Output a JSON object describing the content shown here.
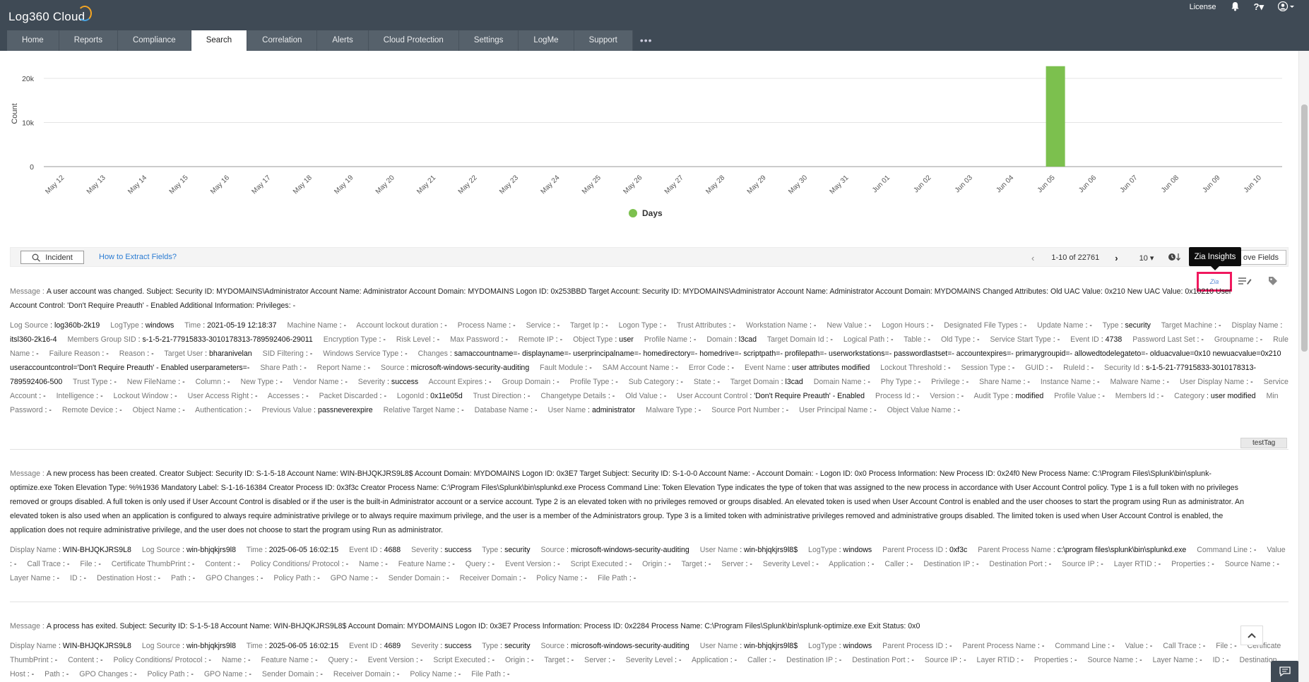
{
  "app": {
    "name": "Log360 Cloud"
  },
  "topright": {
    "license": "License",
    "help": "?"
  },
  "nav": {
    "tabs": [
      "Home",
      "Reports",
      "Compliance",
      "Search",
      "Correlation",
      "Alerts",
      "Cloud Protection",
      "Settings",
      "LogMe",
      "Support"
    ],
    "more": "•••",
    "active": "Search"
  },
  "chart_data": {
    "type": "bar",
    "categories": [
      "May 12",
      "May 13",
      "May 14",
      "May 15",
      "May 16",
      "May 17",
      "May 18",
      "May 19",
      "May 20",
      "May 21",
      "May 22",
      "May 23",
      "May 24",
      "May 25",
      "May 26",
      "May 27",
      "May 28",
      "May 29",
      "May 30",
      "May 31",
      "Jun 01",
      "Jun 02",
      "Jun 03",
      "Jun 04",
      "Jun 05",
      "Jun 06",
      "Jun 07",
      "Jun 08",
      "Jun 09",
      "Jun 10"
    ],
    "series": [
      {
        "name": "Days",
        "values": [
          0,
          0,
          0,
          0,
          0,
          0,
          0,
          0,
          0,
          0,
          0,
          0,
          0,
          0,
          0,
          0,
          0,
          0,
          0,
          0,
          0,
          0,
          0,
          0,
          22761,
          0,
          0,
          0,
          0,
          0
        ]
      }
    ],
    "ylabel": "Count",
    "yticks": [
      "0",
      "10k",
      "20k"
    ],
    "ylim": [
      0,
      24000
    ],
    "legend": "bottom-center",
    "color": "#7cc04e"
  },
  "toolbar": {
    "incident": "Incident",
    "extract_link": "How to Extract Fields?",
    "range": "1-10 of 22761",
    "page_size": "10",
    "fields_btn": "ove Fields",
    "tooltip": "Zia Insights",
    "zia": "Zia"
  },
  "logs": [
    {
      "message_key": "Message :",
      "message": "A user account was changed. Subject: Security ID: MYDOMAINS\\Administrator Account Name: Administrator Account Domain: MYDOMAINS Logon ID: 0x253BBD Target Account: Security ID: MYDOMAINS\\Administrator Account Name: Administrator Account Domain: MYDOMAINS Changed Attributes: Old UAC Value: 0x210 New UAC Value: 0x10210 User Account Control: 'Don't Require Preauth' - Enabled Additional Information: Privileges: -",
      "fields": [
        [
          "Log Source",
          "log360b-2k19"
        ],
        [
          "LogType",
          "windows"
        ],
        [
          "Time",
          "2021-05-19 12:18:37"
        ],
        [
          "Machine Name",
          "-"
        ],
        [
          "Account lockout duration",
          "-"
        ],
        [
          "Process Name",
          "-"
        ],
        [
          "Service",
          "-"
        ],
        [
          "Target Ip",
          "-"
        ],
        [
          "Logon Type",
          "-"
        ],
        [
          "Trust Attributes",
          "-"
        ],
        [
          "Workstation Name",
          "-"
        ],
        [
          "New Value",
          "-"
        ],
        [
          "Logon Hours",
          "-"
        ],
        [
          "Designated File Types",
          "-"
        ],
        [
          "Update Name",
          "-"
        ],
        [
          "Type",
          "security"
        ],
        [
          "Target Machine",
          "-"
        ],
        [
          "Display Name",
          "itsl360-2k16-4"
        ],
        [
          "Members Group SID",
          "s-1-5-21-77915833-3010178313-789592406-29011"
        ],
        [
          "Encryption Type",
          "-"
        ],
        [
          "Risk Level",
          "-"
        ],
        [
          "Max Password",
          "-"
        ],
        [
          "Remote IP",
          "-"
        ],
        [
          "Object Type",
          "user"
        ],
        [
          "Profile Name",
          "-"
        ],
        [
          "Domain",
          "l3cad"
        ],
        [
          "Target Domain Id",
          "-"
        ],
        [
          "Logical Path",
          "-"
        ],
        [
          "Table",
          "-"
        ],
        [
          "Old Type",
          "-"
        ],
        [
          "Service Start Type",
          "-"
        ],
        [
          "Event ID",
          "4738"
        ],
        [
          "Password Last Set",
          "-"
        ],
        [
          "Groupname",
          "-"
        ],
        [
          "Rule Name",
          "-"
        ],
        [
          "Failure Reason",
          "-"
        ],
        [
          "Reason",
          "-"
        ],
        [
          "Target User",
          "bharanivelan"
        ],
        [
          "SID Filtering",
          "-"
        ],
        [
          "Windows Service Type",
          "-"
        ],
        [
          "Changes",
          "samaccountname=- displayname=- userprincipalname=- homedirectory=- homedrive=- scriptpath=- profilepath=- userworkstations=- passwordlastset=- accountexpires=- primarygroupid=- allowedtodelegateto=- olduacvalue=0x10 newuacvalue=0x210 useraccountcontrol='Don't Require Preauth' - Enabled userparameters=-"
        ],
        [
          "Share Path",
          "-"
        ],
        [
          "Report Name",
          "-"
        ],
        [
          "Source",
          "microsoft-windows-security-auditing"
        ],
        [
          "Fault Module",
          "-"
        ],
        [
          "SAM Account Name",
          "-"
        ],
        [
          "Error Code",
          "-"
        ],
        [
          "Event Name",
          "user attributes modified"
        ],
        [
          "Lockout Threshold",
          "-"
        ],
        [
          "Session Type",
          "-"
        ],
        [
          "GUID",
          "-"
        ],
        [
          "RuleId",
          "-"
        ],
        [
          "Security Id",
          "s-1-5-21-77915833-3010178313-789592406-500"
        ],
        [
          "Trust Type",
          "-"
        ],
        [
          "New FileName",
          "-"
        ],
        [
          "Column",
          "-"
        ],
        [
          "New Type",
          "-"
        ],
        [
          "Vendor Name",
          "-"
        ],
        [
          "Severity",
          "success"
        ],
        [
          "Account Expires",
          "-"
        ],
        [
          "Group Domain",
          "-"
        ],
        [
          "Profile Type",
          "-"
        ],
        [
          "Sub Category",
          "-"
        ],
        [
          "State",
          "-"
        ],
        [
          "Target Domain",
          "l3cad"
        ],
        [
          "Domain Name",
          "-"
        ],
        [
          "Phy Type",
          "-"
        ],
        [
          "Privilege",
          "-"
        ],
        [
          "Share Name",
          "-"
        ],
        [
          "Instance Name",
          "-"
        ],
        [
          "Malware Name",
          "-"
        ],
        [
          "User Display Name",
          "-"
        ],
        [
          "Service Account",
          "-"
        ],
        [
          "Intelligence",
          "-"
        ],
        [
          "Lockout Window",
          "-"
        ],
        [
          "User Access Right",
          "-"
        ],
        [
          "Accesses",
          "-"
        ],
        [
          "Packet Discarded",
          "-"
        ],
        [
          "LogonId",
          "0x11e05d"
        ],
        [
          "Trust Direction",
          "-"
        ],
        [
          "Changetype Details",
          "-"
        ],
        [
          "Old Value",
          "-"
        ],
        [
          "User Account Control",
          "'Don't Require Preauth' - Enabled"
        ],
        [
          "Process Id",
          "-"
        ],
        [
          "Version",
          "-"
        ],
        [
          "Audit Type",
          "modified"
        ],
        [
          "Profile Value",
          "-"
        ],
        [
          "Members Id",
          "-"
        ],
        [
          "Category",
          "user modified"
        ],
        [
          "Min Password",
          "-"
        ],
        [
          "Remote Device",
          "-"
        ],
        [
          "Object Name",
          "-"
        ],
        [
          "Authentication",
          "-"
        ],
        [
          "Previous Value",
          "passneverexpire"
        ],
        [
          "Relative Target Name",
          "-"
        ],
        [
          "Database Name",
          "-"
        ],
        [
          "User Name",
          "administrator"
        ],
        [
          "Malware Type",
          "-"
        ],
        [
          "Source Port Number",
          "-"
        ],
        [
          "User Principal Name",
          "-"
        ],
        [
          "Object Value Name",
          "-"
        ]
      ],
      "tag": "testTag"
    },
    {
      "message_key": "Message :",
      "message": "A new process has been created. Creator Subject: Security ID: S-1-5-18 Account Name: WIN-BHJQKJRS9L8$ Account Domain: MYDOMAINS Logon ID: 0x3E7 Target Subject: Security ID: S-1-0-0 Account Name: - Account Domain: - Logon ID: 0x0 Process Information: New Process ID: 0x24f0 New Process Name: C:\\Program Files\\Splunk\\bin\\splunk-optimize.exe Token Elevation Type: %%1936 Mandatory Label: S-1-16-16384 Creator Process ID: 0x3f3c Creator Process Name: C:\\Program Files\\Splunk\\bin\\splunkd.exe Process Command Line: Token Elevation Type indicates the type of token that was assigned to the new process in accordance with User Account Control policy. Type 1 is a full token with no privileges removed or groups disabled. A full token is only used if User Account Control is disabled or if the user is the built-in Administrator account or a service account. Type 2 is an elevated token with no privileges removed or groups disabled. An elevated token is used when User Account Control is enabled and the user chooses to start the program using Run as administrator. An elevated token is also used when an application is configured to always require administrative privilege or to always require maximum privilege, and the user is a member of the Administrators group. Type 3 is a limited token with administrative privileges removed and administrative groups disabled. The limited token is used when User Account Control is enabled, the application does not require administrative privilege, and the user does not choose to start the program using Run as administrator.",
      "fields": [
        [
          "Display Name",
          "WIN-BHJQKJRS9L8"
        ],
        [
          "Log Source",
          "win-bhjqkjrs9l8"
        ],
        [
          "Time",
          "2025-06-05 16:02:15"
        ],
        [
          "Event ID",
          "4688"
        ],
        [
          "Severity",
          "success"
        ],
        [
          "Type",
          "security"
        ],
        [
          "Source",
          "microsoft-windows-security-auditing"
        ],
        [
          "User Name",
          "win-bhjqkjrs9l8$"
        ],
        [
          "LogType",
          "windows"
        ],
        [
          "Parent Process ID",
          "0xf3c"
        ],
        [
          "Parent Process Name",
          "c:\\program files\\splunk\\bin\\splunkd.exe"
        ],
        [
          "Command Line",
          "-"
        ],
        [
          "Value",
          "-"
        ],
        [
          "Call Trace",
          "-"
        ],
        [
          "File",
          "-"
        ],
        [
          "Certificate ThumbPrint",
          "-"
        ],
        [
          "Content",
          "-"
        ],
        [
          "Policy Conditions/ Protocol",
          "-"
        ],
        [
          "Name",
          "-"
        ],
        [
          "Feature Name",
          "-"
        ],
        [
          "Query",
          "-"
        ],
        [
          "Event Version",
          "-"
        ],
        [
          "Script Executed",
          "-"
        ],
        [
          "Origin",
          "-"
        ],
        [
          "Target",
          "-"
        ],
        [
          "Server",
          "-"
        ],
        [
          "Severity Level",
          "-"
        ],
        [
          "Application",
          "-"
        ],
        [
          "Caller",
          "-"
        ],
        [
          "Destination IP",
          "-"
        ],
        [
          "Destination Port",
          "-"
        ],
        [
          "Source IP",
          "-"
        ],
        [
          "Layer RTID",
          "-"
        ],
        [
          "Properties",
          "-"
        ],
        [
          "Source Name",
          "-"
        ],
        [
          "Layer Name",
          "-"
        ],
        [
          "ID",
          "-"
        ],
        [
          "Destination Host",
          "-"
        ],
        [
          "Path",
          "-"
        ],
        [
          "GPO Changes",
          "-"
        ],
        [
          "Policy Path",
          "-"
        ],
        [
          "GPO Name",
          "-"
        ],
        [
          "Sender Domain",
          "-"
        ],
        [
          "Receiver Domain",
          "-"
        ],
        [
          "Policy Name",
          "-"
        ],
        [
          "File Path",
          "-"
        ]
      ]
    },
    {
      "message_key": "Message :",
      "message": "A process has exited. Subject: Security ID: S-1-5-18 Account Name: WIN-BHJQKJRS9L8$ Account Domain: MYDOMAINS Logon ID: 0x3E7 Process Information: Process ID: 0x2284 Process Name: C:\\Program Files\\Splunk\\bin\\splunk-optimize.exe Exit Status: 0x0",
      "fields": [
        [
          "Display Name",
          "WIN-BHJQKJRS9L8"
        ],
        [
          "Log Source",
          "win-bhjqkjrs9l8"
        ],
        [
          "Time",
          "2025-06-05 16:02:15"
        ],
        [
          "Event ID",
          "4689"
        ],
        [
          "Severity",
          "success"
        ],
        [
          "Type",
          "security"
        ],
        [
          "Source",
          "microsoft-windows-security-auditing"
        ],
        [
          "User Name",
          "win-bhjqkjrs9l8$"
        ],
        [
          "LogType",
          "windows"
        ],
        [
          "Parent Process ID",
          "-"
        ],
        [
          "Parent Process Name",
          "-"
        ],
        [
          "Command Line",
          "-"
        ],
        [
          "Value",
          "-"
        ],
        [
          "Call Trace",
          "-"
        ],
        [
          "File",
          "-"
        ],
        [
          "Certificate ThumbPrint",
          "-"
        ],
        [
          "Content",
          "-"
        ],
        [
          "Policy Conditions/ Protocol",
          "-"
        ],
        [
          "Name",
          "-"
        ],
        [
          "Feature Name",
          "-"
        ],
        [
          "Query",
          "-"
        ],
        [
          "Event Version",
          "-"
        ],
        [
          "Script Executed",
          "-"
        ],
        [
          "Origin",
          "-"
        ],
        [
          "Target",
          "-"
        ],
        [
          "Server",
          "-"
        ],
        [
          "Severity Level",
          "-"
        ],
        [
          "Application",
          "-"
        ],
        [
          "Caller",
          "-"
        ],
        [
          "Destination IP",
          "-"
        ],
        [
          "Destination Port",
          "-"
        ],
        [
          "Source IP",
          "-"
        ],
        [
          "Layer RTID",
          "-"
        ],
        [
          "Properties",
          "-"
        ],
        [
          "Source Name",
          "-"
        ],
        [
          "Layer Name",
          "-"
        ],
        [
          "ID",
          "-"
        ],
        [
          "Destination Host",
          "-"
        ],
        [
          "Path",
          "-"
        ],
        [
          "GPO Changes",
          "-"
        ],
        [
          "Policy Path",
          "-"
        ],
        [
          "GPO Name",
          "-"
        ],
        [
          "Sender Domain",
          "-"
        ],
        [
          "Receiver Domain",
          "-"
        ],
        [
          "Policy Name",
          "-"
        ],
        [
          "File Path",
          "-"
        ]
      ]
    }
  ]
}
